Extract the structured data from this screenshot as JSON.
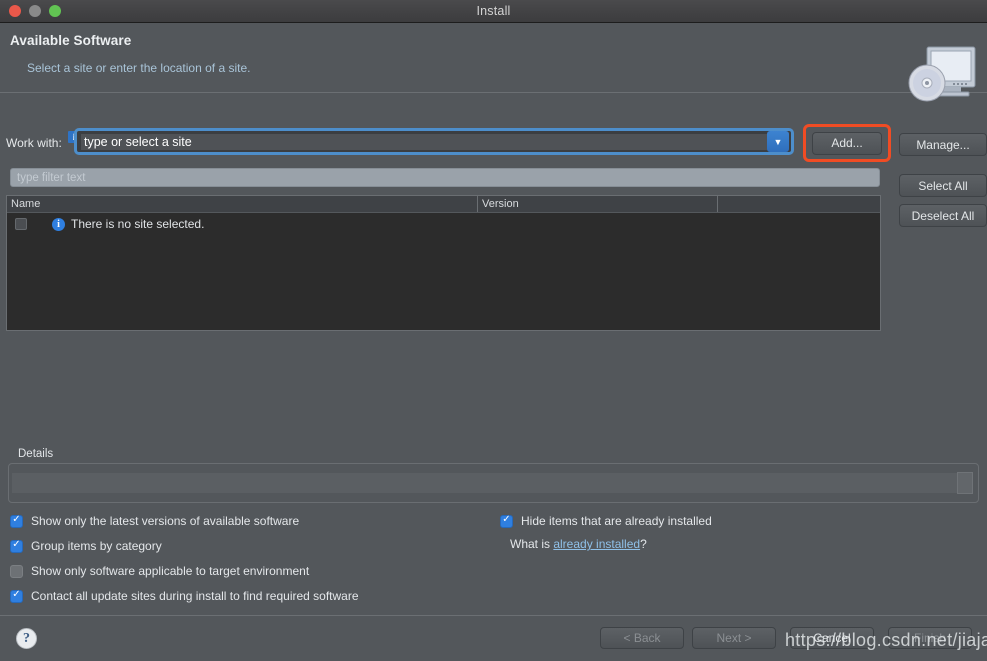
{
  "window": {
    "title": "Install",
    "traffic_lights": [
      "close-button",
      "minimize-button",
      "zoom-button"
    ]
  },
  "header": {
    "title": "Available Software",
    "subtitle": "Select a site or enter the location of a site.",
    "art_icon": "installer-disc-monitor-icon"
  },
  "work_with": {
    "label": "Work with:",
    "info_badge": "i",
    "value": "type or select a site",
    "placeholder": "type or select a site",
    "dropdown_icon": "chevron-down-icon"
  },
  "buttons": {
    "add": "Add...",
    "manage": "Manage...",
    "select_all": "Select All",
    "deselect_all": "Deselect All"
  },
  "filter": {
    "placeholder": "type filter text"
  },
  "table": {
    "columns": [
      "Name",
      "Version",
      ""
    ],
    "rows": [
      {
        "checked": false,
        "icon": "info-icon",
        "name": "There is no site selected.",
        "version": ""
      }
    ]
  },
  "details": {
    "label": "Details"
  },
  "options": {
    "left": [
      {
        "label": "Show only the latest versions of available software",
        "checked": true
      },
      {
        "label": "Group items by category",
        "checked": true
      },
      {
        "label": "Show only software applicable to target environment",
        "checked": false
      },
      {
        "label": "Contact all update sites during install to find required software",
        "checked": true
      }
    ],
    "right": [
      {
        "label": "Hide items that are already installed",
        "checked": true
      }
    ],
    "what_is_prefix": "What is ",
    "what_is_link": "already installed",
    "what_is_suffix": "?"
  },
  "footer": {
    "help_icon": "help-question-icon",
    "back": "< Back",
    "next": "Next >",
    "cancel": "Cancel",
    "finish": "Finish"
  },
  "watermark": {
    "text": "https://blog.csdn.net/jiajane"
  },
  "colors": {
    "dialog_background": "#53575b",
    "table_background": "#2c2c2c",
    "accent_blue": "#2f7fe0",
    "highlight_orange": "#f04c24",
    "link_blue": "#8fc0e8",
    "filter_background": "#9aa2aa"
  }
}
